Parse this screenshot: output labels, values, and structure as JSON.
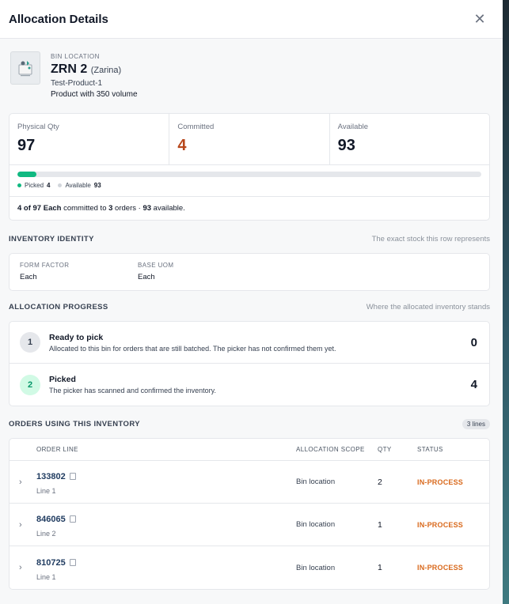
{
  "header": {
    "title": "Allocation Details",
    "close_glyph": "✕"
  },
  "product": {
    "bin_label": "BIN LOCATION",
    "bin_name": "ZRN 2",
    "bin_sub": "(Zarina)",
    "sku": "Test-Product-1",
    "description": "Product with 350 volume"
  },
  "stats": {
    "physical_label": "Physical Qty",
    "physical_value": "97",
    "committed_label": "Committed",
    "committed_value": "4",
    "available_label": "Available",
    "available_value": "93",
    "picked_fraction": 0.041,
    "legend_picked_label": "Picked",
    "legend_picked_value": "4",
    "legend_available_label": "Available",
    "legend_available_value": "93",
    "summary": {
      "part1": "4 of 97 Each",
      "part2": " committed to ",
      "part3": "3",
      "part4": " orders · ",
      "part5": "93",
      "part6": " available."
    },
    "colors": {
      "picked": "#10b981",
      "committed": "#b7471b"
    }
  },
  "identity": {
    "title": "INVENTORY IDENTITY",
    "hint": "The exact stock this row represents",
    "form_factor_label": "FORM FACTOR",
    "form_factor_value": "Each",
    "base_uom_label": "BASE UOM",
    "base_uom_value": "Each"
  },
  "progress": {
    "title": "ALLOCATION PROGRESS",
    "hint": "Where the allocated inventory stands",
    "steps": [
      {
        "num": "1",
        "title": "Ready to pick",
        "desc": "Allocated to this bin for orders that are still batched. The picker has not confirmed them yet.",
        "count": "0"
      },
      {
        "num": "2",
        "title": "Picked",
        "desc": "The picker has scanned and confirmed the inventory.",
        "count": "4"
      }
    ]
  },
  "orders": {
    "title": "ORDERS USING THIS INVENTORY",
    "badge": "3 lines",
    "columns": {
      "order_line": "ORDER LINE",
      "scope": "ALLOCATION SCOPE",
      "qty": "QTY",
      "status": "STATUS"
    },
    "rows": [
      {
        "id": "133802",
        "line": "Line 1",
        "scope": "Bin location",
        "qty": "2",
        "status": "IN-PROCESS"
      },
      {
        "id": "846065",
        "line": "Line 2",
        "scope": "Bin location",
        "qty": "1",
        "status": "IN-PROCESS"
      },
      {
        "id": "810725",
        "line": "Line 1",
        "scope": "Bin location",
        "qty": "1",
        "status": "IN-PROCESS"
      }
    ],
    "status_color": "#d9691c"
  }
}
